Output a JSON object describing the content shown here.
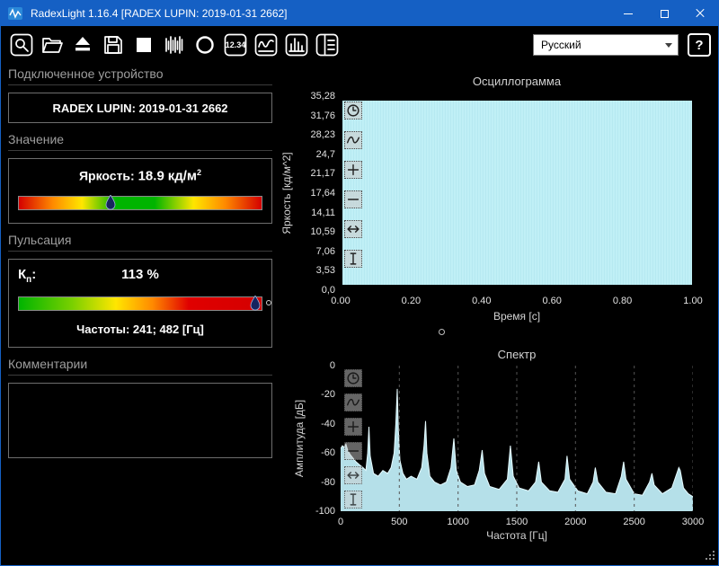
{
  "window": {
    "title": "RadexLight 1.16.4 [RADEX LUPIN: 2019-01-31 2662]"
  },
  "titlebar": {
    "controls": [
      "minimize",
      "maximize",
      "close"
    ]
  },
  "toolbar": {
    "buttons": [
      {
        "name": "search-device-button",
        "icon": "magnifier"
      },
      {
        "name": "open-file-button",
        "icon": "folder-open"
      },
      {
        "name": "eject-button",
        "icon": "eject"
      },
      {
        "name": "save-button",
        "icon": "save"
      },
      {
        "name": "stop-button",
        "icon": "stop"
      },
      {
        "name": "record-button",
        "icon": "waveform"
      },
      {
        "name": "measure-button",
        "icon": "circle"
      },
      {
        "name": "numeric-display-button",
        "icon": "digits",
        "label": "12.34"
      },
      {
        "name": "oscillogram-view-button",
        "icon": "oscillogram"
      },
      {
        "name": "spectrum-view-button",
        "icon": "spectrum-bars"
      },
      {
        "name": "layout-view-button",
        "icon": "layout"
      }
    ],
    "language_select": {
      "value": "Русский"
    },
    "help_label": "?"
  },
  "left_panel": {
    "device_section": {
      "header": "Подключенное устройство",
      "device": "RADEX LUPIN: 2019-01-31 2662"
    },
    "value_section": {
      "header": "Значение",
      "label": "Яркость:",
      "value": "18.9",
      "unit": "кд/м",
      "unit_sup": "2",
      "marker_percent": 38
    },
    "pulsation_section": {
      "header": "Пульсация",
      "kp_label": "К",
      "kp_sub": "п",
      "kp_colon": ":",
      "kp_value": "113 %",
      "marker_percent": 97,
      "frequencies": "Частоты: 241; 482 [Гц]"
    },
    "comments_section": {
      "header": "Комментарии",
      "text": ""
    }
  },
  "charts": {
    "oscillogram": {
      "title": "Осциллограмма",
      "ylabel": "Яркость [кд/м^2]",
      "xlabel": "Время [с]",
      "yticks": [
        "35,28",
        "31,76",
        "28,23",
        "24,7",
        "21,17",
        "17,64",
        "14,11",
        "10,59",
        "7,06",
        "3,53",
        "0,0"
      ],
      "xticks": [
        "0.00",
        "0.20",
        "0.40",
        "0.60",
        "0.80",
        "1.00"
      ]
    },
    "spectrum": {
      "title": "Спектр",
      "ylabel": "Амплитуда [дБ]",
      "xlabel": "Частота [Гц]",
      "yticks": [
        "0",
        "-20",
        "-40",
        "-60",
        "-80",
        "-100"
      ],
      "xticks": [
        "0",
        "500",
        "1000",
        "1500",
        "2000",
        "2500",
        "3000"
      ]
    },
    "tools": [
      "clock",
      "curve",
      "zoom-in",
      "zoom-out",
      "pan-horizontal",
      "cursor"
    ]
  },
  "chart_data": [
    {
      "id": "oscillogram",
      "type": "line",
      "title": "Осциллограмма",
      "xlabel": "Время [с]",
      "ylabel": "Яркость [кд/м^2]",
      "xlim": [
        0,
        1
      ],
      "ylim": [
        0,
        35.28
      ],
      "description": "Dense high-frequency luminance oscillation (pulsating light) filling the plot area as a solid band",
      "envelope": {
        "t": [
          0,
          1
        ],
        "min": 0.8,
        "max": 34.9
      }
    },
    {
      "id": "spectrum",
      "type": "area",
      "title": "Спектр",
      "xlabel": "Частота [Гц]",
      "ylabel": "Амплитуда [дБ]",
      "xlim": [
        0,
        3000
      ],
      "ylim": [
        -100,
        0
      ],
      "x": [
        0,
        15,
        30,
        45,
        60,
        80,
        100,
        130,
        160,
        190,
        215,
        230,
        241,
        252,
        280,
        320,
        360,
        400,
        430,
        455,
        470,
        482,
        492,
        505,
        530,
        560,
        600,
        650,
        690,
        710,
        723,
        735,
        760,
        800,
        850,
        900,
        940,
        964,
        985,
        1020,
        1080,
        1140,
        1180,
        1205,
        1225,
        1270,
        1350,
        1420,
        1446,
        1470,
        1520,
        1600,
        1660,
        1687,
        1710,
        1780,
        1850,
        1910,
        1928,
        1950,
        2020,
        2100,
        2150,
        2169,
        2190,
        2260,
        2340,
        2390,
        2410,
        2430,
        2500,
        2570,
        2630,
        2651,
        2670,
        2740,
        2820,
        2880,
        2892,
        2920,
        2960,
        3000
      ],
      "y": [
        -57,
        -55,
        -56,
        -54,
        -58,
        -61,
        -63,
        -66,
        -68,
        -70,
        -72,
        -60,
        -42,
        -62,
        -74,
        -76,
        -72,
        -74,
        -70,
        -60,
        -40,
        -16,
        -45,
        -65,
        -74,
        -78,
        -76,
        -78,
        -70,
        -55,
        -38,
        -60,
        -76,
        -80,
        -82,
        -80,
        -70,
        -50,
        -72,
        -80,
        -83,
        -82,
        -72,
        -58,
        -74,
        -83,
        -85,
        -78,
        -55,
        -76,
        -84,
        -86,
        -80,
        -66,
        -80,
        -86,
        -87,
        -78,
        -62,
        -78,
        -86,
        -88,
        -80,
        -70,
        -80,
        -87,
        -88,
        -76,
        -66,
        -78,
        -88,
        -89,
        -80,
        -74,
        -82,
        -88,
        -84,
        -70,
        -72,
        -84,
        -88,
        -90
      ],
      "peaks": [
        {
          "hz": 241,
          "db": -42
        },
        {
          "hz": 482,
          "db": -16
        },
        {
          "hz": 723,
          "db": -38
        },
        {
          "hz": 964,
          "db": -50
        },
        {
          "hz": 1205,
          "db": -58
        },
        {
          "hz": 1446,
          "db": -55
        },
        {
          "hz": 1928,
          "db": -62
        },
        {
          "hz": 2410,
          "db": -66
        },
        {
          "hz": 2892,
          "db": -70
        }
      ]
    }
  ],
  "colors": {
    "titlebar": "#1560c4",
    "trace": "#bfecf6",
    "marker": "#16245f"
  }
}
